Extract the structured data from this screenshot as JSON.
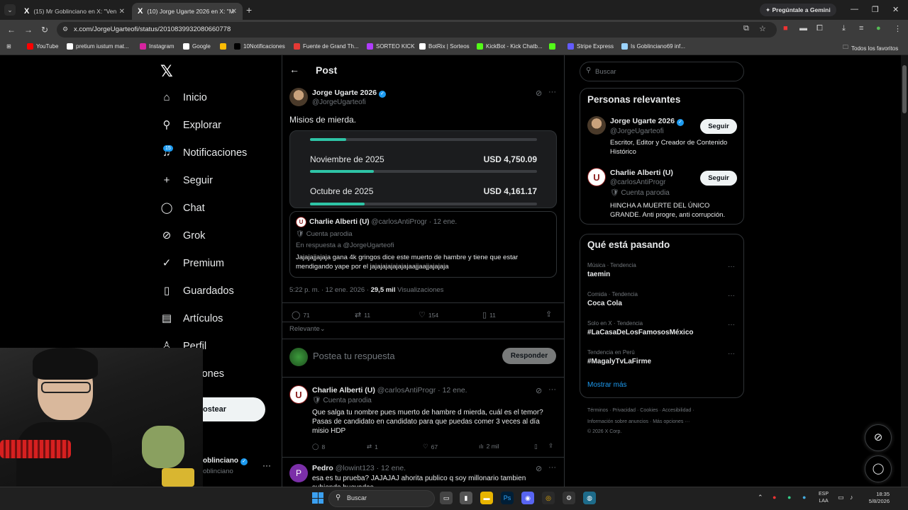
{
  "browser": {
    "tabs": [
      {
        "title": "(15) Mr Goblinciano en X: \"Ven"
      },
      {
        "title": "(10) Jorge Ugarte 2026 en X: \"M"
      }
    ],
    "gemini_label": "Pregúntale a Gemini",
    "url": "x.com/JorgeUgarteofi/status/2010839932080660778",
    "bookmarks": [
      {
        "label": "YouTube",
        "color": "#ff0000"
      },
      {
        "label": "pretium iustum mat...",
        "color": "#ffffff"
      },
      {
        "label": "Instagram",
        "color": "#d6249f"
      },
      {
        "label": "Google",
        "color": "#ffffff"
      },
      {
        "label": "",
        "color": "#fbbc05"
      },
      {
        "label": "10Notificaciones",
        "color": "#000000"
      },
      {
        "label": "Fuente de Grand Th...",
        "color": "#e53935"
      },
      {
        "label": "SORTEO KICK",
        "color": "#b03cff"
      },
      {
        "label": "BotRix | Sorteos",
        "color": "#ffffff"
      },
      {
        "label": "KickBot - Kick Chatb...",
        "color": "#53fc18"
      },
      {
        "label": "",
        "color": "#53fc18"
      },
      {
        "label": "Stripe Express",
        "color": "#635bff"
      },
      {
        "label": "Is Goblinciano69 inf...",
        "color": "#9bd3ff"
      }
    ],
    "all_favorites": "Todos los favoritos"
  },
  "nav": {
    "items": [
      {
        "label": "Inicio",
        "icon": "home-icon",
        "glyph": "⌂"
      },
      {
        "label": "Explorar",
        "icon": "search-icon",
        "glyph": "⚲"
      },
      {
        "label": "Notificaciones",
        "icon": "bell-icon",
        "glyph": "🔔"
      },
      {
        "label": "Seguir",
        "icon": "follow-icon",
        "glyph": "👤"
      },
      {
        "label": "Chat",
        "icon": "chat-icon",
        "glyph": "◯"
      },
      {
        "label": "Grok",
        "icon": "grok-icon",
        "glyph": "⊘"
      },
      {
        "label": "Premium",
        "icon": "premium-icon",
        "glyph": "✓"
      },
      {
        "label": "Guardados",
        "icon": "bookmark-icon",
        "glyph": "▯"
      },
      {
        "label": "Artículos",
        "icon": "articles-icon",
        "glyph": "▤"
      },
      {
        "label": "Perfil",
        "icon": "profile-icon",
        "glyph": "👤"
      },
      {
        "label": "opciones",
        "icon": "more-icon",
        "glyph": ""
      }
    ],
    "notif_badge": "15",
    "post_button": "ostear",
    "account_name": "oblinciano",
    "account_handle": "oblinciano"
  },
  "header": {
    "title": "Post"
  },
  "post": {
    "author": "Jorge Ugarte 2026",
    "handle": "@JorgeUgarteofi",
    "text": "Misios de mierda.",
    "image": {
      "rows": [
        {
          "label": "Noviembre de 2025",
          "amount": "USD 4,750.09",
          "fill": 0.28
        },
        {
          "label": "Octubre de 2025",
          "amount": "USD 4,161.17",
          "fill": 0.24
        }
      ],
      "top_fill": 0.16
    },
    "quote": {
      "author": "Charlie Alberti (U)",
      "handle": "@carlosAntiProgr",
      "date": "· 12 ene.",
      "badge": "Cuenta parodia",
      "reply_to": "En respuesta a @JorgeUgarteofi",
      "text": "Jajajajjajaja gana 4k gringos dice este muerto de hambre y tiene que estar mendigando yape por el jajajajajajajajaajjaajjajajaja"
    },
    "time": "5:22 p. m. · 12 ene. 2026 ·",
    "views_count": "29,5 mil",
    "views_label": "Visualizaciones",
    "stats": {
      "replies": "71",
      "reposts": "11",
      "likes": "154",
      "bookmarks": "11"
    },
    "sort_label": "Relevante"
  },
  "compose": {
    "placeholder": "Postea tu respuesta",
    "button": "Responder"
  },
  "replies": [
    {
      "author": "Charlie Alberti (U)",
      "handle": "@carlosAntiProgr",
      "date": "· 12 ene.",
      "badge": "Cuenta parodia",
      "text": "Que salga tu nombre pues muerto de hambre d mierda, cuál es el temor? Pasas de candidato en candidato para que puedas comer 3 veces al día misio HDP",
      "stats": {
        "replies": "8",
        "reposts": "1",
        "likes": "67",
        "views": "2 mil"
      }
    },
    {
      "author": "Pedro",
      "handle": "@lowint123",
      "date": "· 12 ene.",
      "avatar_letter": "P",
      "text": "esa es tu prueba? JAJAJAJ ahorita publico q soy millonario tambien subiendo huevadas"
    }
  ],
  "sidebar": {
    "search_placeholder": "Buscar",
    "relevant": {
      "title": "Personas relevantes",
      "people": [
        {
          "name": "Jorge Ugarte 2026",
          "handle": "@JorgeUgarteofi",
          "bio": "Escritor, Editor y Creador de Contenido Histórico",
          "follow": "Seguir"
        },
        {
          "name": "Charlie Alberti (U)",
          "handle": "@carlosAntiProgr",
          "badge": "Cuenta parodia",
          "bio": "HINCHA A MUERTE DEL ÚNICO GRANDE. Anti progre, anti corrupción.",
          "follow": "Seguir"
        }
      ]
    },
    "trending": {
      "title": "Qué está pasando",
      "items": [
        {
          "category": "Música · Tendencia",
          "name": "taemin"
        },
        {
          "category": "Comida · Tendencia",
          "name": "Coca Cola"
        },
        {
          "category": "Solo en X · Tendencia",
          "name": "#LaCasaDeLosFamososMéxico"
        },
        {
          "category": "Tendencia en Perú",
          "name": "#MagalyTvLaFirme"
        }
      ],
      "show_more": "Mostrar más"
    },
    "footer": {
      "line1": "Términos · Privacidad · Cookies · Accesibilidad ·",
      "line2": "Información sobre anuncios · Más opciones ···",
      "line3": "© 2026 X Corp."
    }
  },
  "taskbar": {
    "search": "Buscar",
    "lang_top": "ESP",
    "lang_bottom": "LAA",
    "time": "18:35",
    "date": "5/8/2026"
  }
}
